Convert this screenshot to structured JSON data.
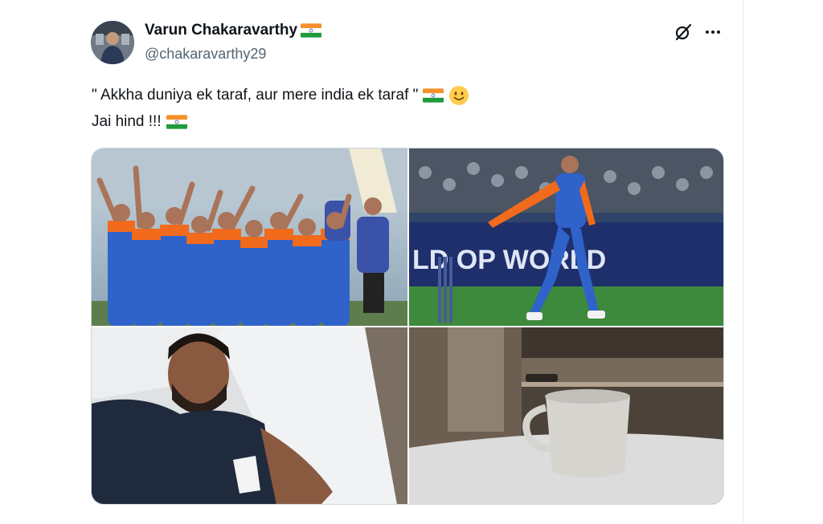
{
  "tweet": {
    "author": {
      "display_name": "Varun Chakaravarthy",
      "handle": "@chakaravarthy29",
      "flag_icon": "india-flag-icon"
    },
    "text": {
      "line1": "\" Akkha duniya ek taraf, aur mere india ek taraf \"",
      "line2": "Jai hind !!!"
    },
    "actions": {
      "grok_icon": "grok-icon",
      "more_icon": "more-options-icon"
    },
    "media": [
      {
        "name": "team-celebration-photo"
      },
      {
        "name": "bowler-celebration-photo",
        "banner_text": "LD  OP WORLD"
      },
      {
        "name": "selfie-in-bed-photo"
      },
      {
        "name": "coffee-mug-on-bed-photo"
      }
    ]
  },
  "colors": {
    "text_primary": "#0f1419",
    "text_secondary": "#536471",
    "border": "#cfd9de",
    "jersey_blue": "#2f63c9",
    "jersey_orange": "#f26a1b"
  }
}
